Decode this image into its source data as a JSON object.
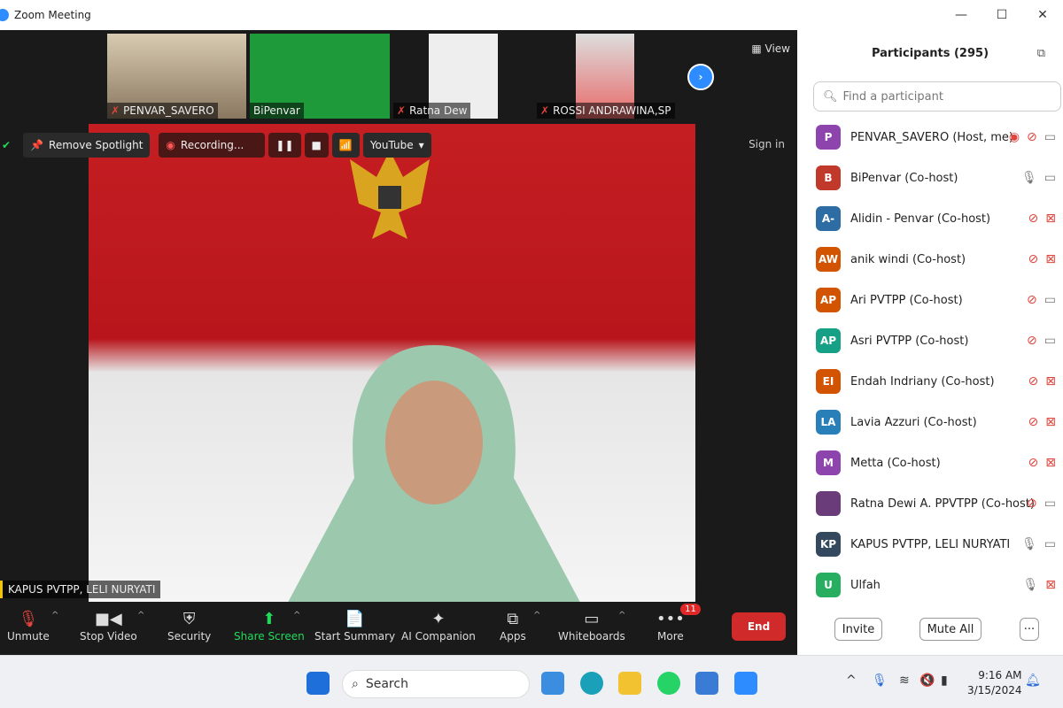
{
  "window": {
    "title": "Zoom Meeting",
    "minimize": "—",
    "maximize": "☐",
    "close": "✕"
  },
  "thumbnails": [
    {
      "name": "PENVAR_SAVERO",
      "muted": true
    },
    {
      "name": "BiPenvar",
      "muted": false
    },
    {
      "name": "Ratna Dew",
      "muted": true
    },
    {
      "name": "ROSSI ANDRAWINA,SP",
      "muted": true
    }
  ],
  "view_label": "View",
  "top_tools": {
    "remove_spotlight": "Remove Spotlight",
    "recording": "Recording...",
    "youtube": "YouTube",
    "sign_in": "Sign in"
  },
  "speaker": "KAPUS PVTPP, LELI NURYATI",
  "toolbar": {
    "unmute": "Unmute",
    "stop_video": "Stop Video",
    "security": "Security",
    "share_screen": "Share Screen",
    "start_summary": "Start Summary",
    "ai_companion": "AI Companion",
    "apps": "Apps",
    "whiteboards": "Whiteboards",
    "more": "More",
    "more_badge": "11",
    "end": "End"
  },
  "panel": {
    "title": "Participants (295)",
    "search_placeholder": "Find a participant",
    "invite": "Invite",
    "mute_all": "Mute All",
    "more": "···",
    "participants": [
      {
        "initials": "P",
        "name": "PENVAR_SAVERO (Host, me)",
        "color": "#8e44ad",
        "mic": "muted",
        "video": "on",
        "recording": true
      },
      {
        "initials": "B",
        "name": "BiPenvar (Co-host)",
        "color": "#c0392b",
        "mic": "on",
        "video": "on"
      },
      {
        "initials": "A-",
        "name": "Alidin - Penvar (Co-host)",
        "color": "#2e6da4",
        "mic": "muted",
        "video": "off"
      },
      {
        "initials": "AW",
        "name": "anik windi (Co-host)",
        "color": "#d35400",
        "mic": "muted",
        "video": "off"
      },
      {
        "initials": "AP",
        "name": "Ari PVTPP (Co-host)",
        "color": "#d35400",
        "mic": "muted",
        "video": "on"
      },
      {
        "initials": "AP",
        "name": "Asri PVTPP (Co-host)",
        "color": "#16a085",
        "mic": "muted",
        "video": "on"
      },
      {
        "initials": "EI",
        "name": "Endah Indriany (Co-host)",
        "color": "#d35400",
        "mic": "muted",
        "video": "off"
      },
      {
        "initials": "LA",
        "name": "Lavia Azzuri (Co-host)",
        "color": "#2980b9",
        "mic": "muted",
        "video": "off"
      },
      {
        "initials": "M",
        "name": "Metta (Co-host)",
        "color": "#8e44ad",
        "mic": "muted",
        "video": "off"
      },
      {
        "initials": "",
        "name": "Ratna Dewi A. PPVTPP (Co-host)",
        "color": "#6a3d7a",
        "mic": "muted",
        "video": "on"
      },
      {
        "initials": "KP",
        "name": "KAPUS PVTPP, LELI NURYATI",
        "color": "#34495e",
        "mic": "on",
        "video": "on"
      },
      {
        "initials": "U",
        "name": "Ulfah",
        "color": "#27ae60",
        "mic": "on",
        "video": "off"
      }
    ]
  },
  "taskbar": {
    "search": "Search",
    "time": "9:16 AM",
    "date": "3/15/2024"
  }
}
